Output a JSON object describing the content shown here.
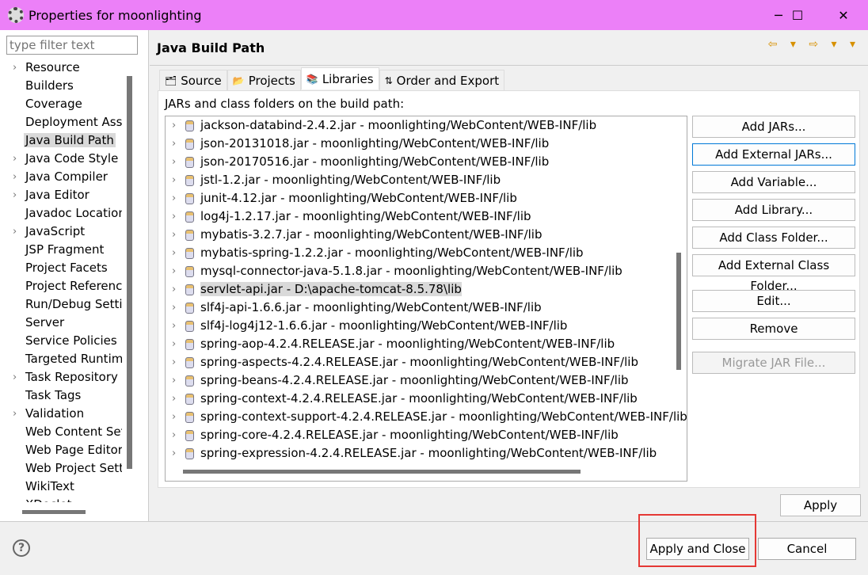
{
  "window": {
    "title": "Properties for moonlighting",
    "controls": [
      "─",
      "☐",
      "✕"
    ]
  },
  "filter": {
    "placeholder": "type filter text"
  },
  "tree": [
    {
      "label": "Resource",
      "expandable": true
    },
    {
      "label": "Builders"
    },
    {
      "label": "Coverage"
    },
    {
      "label": "Deployment Assembly"
    },
    {
      "label": "Java Build Path",
      "selected": true
    },
    {
      "label": "Java Code Style",
      "expandable": true
    },
    {
      "label": "Java Compiler",
      "expandable": true
    },
    {
      "label": "Java Editor",
      "expandable": true
    },
    {
      "label": "Javadoc Location"
    },
    {
      "label": "JavaScript",
      "expandable": true
    },
    {
      "label": "JSP Fragment"
    },
    {
      "label": "Project Facets"
    },
    {
      "label": "Project References"
    },
    {
      "label": "Run/Debug Settings"
    },
    {
      "label": "Server"
    },
    {
      "label": "Service Policies"
    },
    {
      "label": "Targeted Runtimes"
    },
    {
      "label": "Task Repository",
      "expandable": true
    },
    {
      "label": "Task Tags"
    },
    {
      "label": "Validation",
      "expandable": true
    },
    {
      "label": "Web Content Settings"
    },
    {
      "label": "Web Page Editor"
    },
    {
      "label": "Web Project Settings"
    },
    {
      "label": "WikiText"
    },
    {
      "label": "XDoclet",
      "expandable": true
    }
  ],
  "page": {
    "title": "Java Build Path",
    "nav": "⇦ ▾ ⇨ ▾ ▾",
    "tabs": [
      {
        "label": "Source",
        "icon": "source-folder-icon"
      },
      {
        "label": "Projects",
        "icon": "folder-icon"
      },
      {
        "label": "Libraries",
        "icon": "library-icon",
        "active": true
      },
      {
        "label": "Order and Export",
        "icon": "order-export-icon"
      }
    ],
    "list_label": "JARs and class folders on the build path:",
    "jars": [
      "jackson-databind-2.4.2.jar - moonlighting/WebContent/WEB-INF/lib",
      "json-20131018.jar - moonlighting/WebContent/WEB-INF/lib",
      "json-20170516.jar - moonlighting/WebContent/WEB-INF/lib",
      "jstl-1.2.jar - moonlighting/WebContent/WEB-INF/lib",
      "junit-4.12.jar - moonlighting/WebContent/WEB-INF/lib",
      "log4j-1.2.17.jar - moonlighting/WebContent/WEB-INF/lib",
      "mybatis-3.2.7.jar - moonlighting/WebContent/WEB-INF/lib",
      "mybatis-spring-1.2.2.jar - moonlighting/WebContent/WEB-INF/lib",
      "mysql-connector-java-5.1.8.jar - moonlighting/WebContent/WEB-INF/lib",
      "servlet-api.jar - D:\\apache-tomcat-8.5.78\\lib",
      "slf4j-api-1.6.6.jar - moonlighting/WebContent/WEB-INF/lib",
      "slf4j-log4j12-1.6.6.jar - moonlighting/WebContent/WEB-INF/lib",
      "spring-aop-4.2.4.RELEASE.jar - moonlighting/WebContent/WEB-INF/lib",
      "spring-aspects-4.2.4.RELEASE.jar - moonlighting/WebContent/WEB-INF/lib",
      "spring-beans-4.2.4.RELEASE.jar - moonlighting/WebContent/WEB-INF/lib",
      "spring-context-4.2.4.RELEASE.jar - moonlighting/WebContent/WEB-INF/lib",
      "spring-context-support-4.2.4.RELEASE.jar - moonlighting/WebContent/WEB-INF/lib",
      "spring-core-4.2.4.RELEASE.jar - moonlighting/WebContent/WEB-INF/lib",
      "spring-expression-4.2.4.RELEASE.jar - moonlighting/WebContent/WEB-INF/lib"
    ],
    "selected_jar": "servlet-api.jar - D:\\apache-tomcat-8.5.78\\lib",
    "buttons": [
      "Add JARs...",
      "Add External JARs...",
      "Add Variable...",
      "Add Library...",
      "Add Class Folder...",
      "Add External Class Folder...",
      "Edit...",
      "Remove",
      "Migrate JAR File..."
    ],
    "apply": "Apply"
  },
  "footer": {
    "help": "?",
    "apply_close": "Apply and Close",
    "cancel": "Cancel"
  },
  "colors": {
    "titlebar": "#ec80f8",
    "highlight": "#e53935"
  }
}
